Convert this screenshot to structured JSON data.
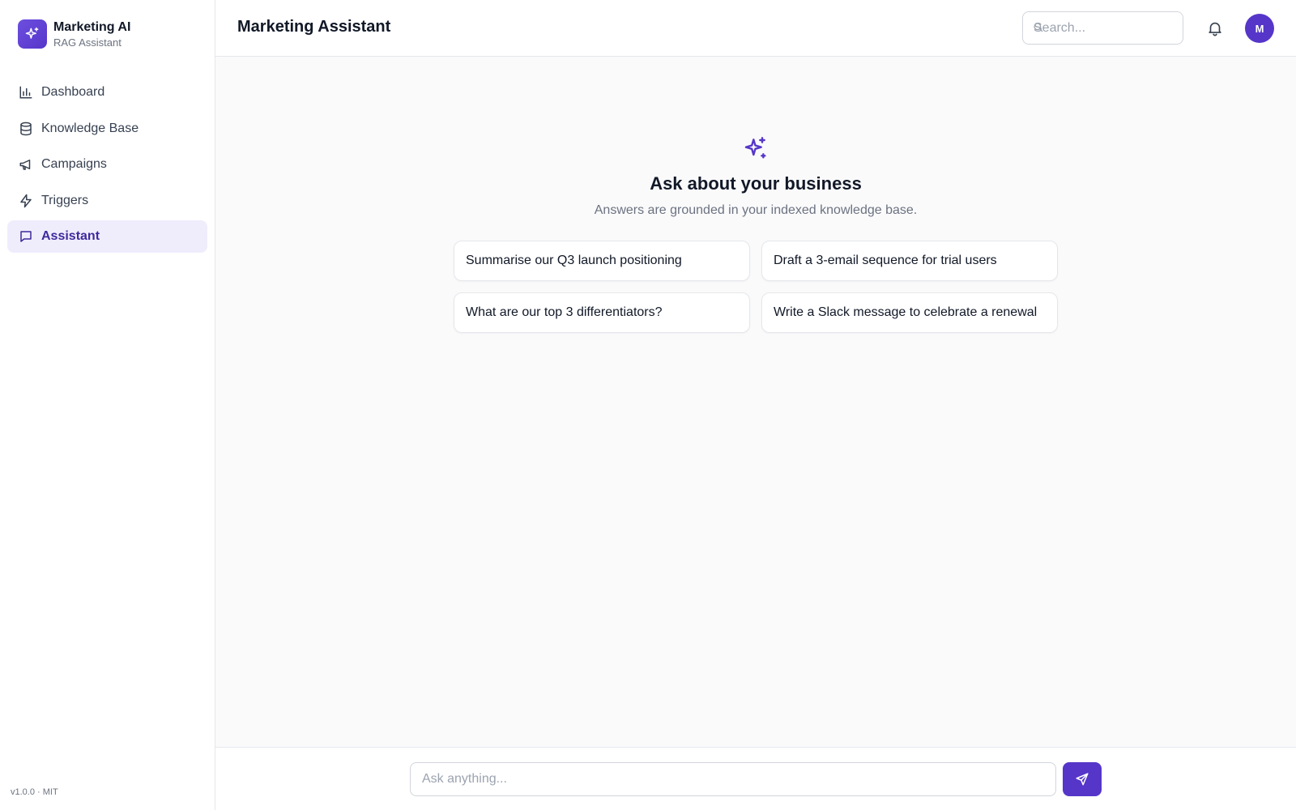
{
  "brand": {
    "name": "Marketing AI",
    "subtitle": "RAG Assistant"
  },
  "sidebar": {
    "items": [
      {
        "label": "Dashboard",
        "icon": "bar-chart-icon",
        "active": false
      },
      {
        "label": "Knowledge Base",
        "icon": "database-icon",
        "active": false
      },
      {
        "label": "Campaigns",
        "icon": "megaphone-icon",
        "active": false
      },
      {
        "label": "Triggers",
        "icon": "lightning-icon",
        "active": false
      },
      {
        "label": "Assistant",
        "icon": "chat-icon",
        "active": true
      }
    ],
    "version": "v1.0.0 · MIT"
  },
  "header": {
    "title": "Marketing Assistant",
    "search_placeholder": "Search...",
    "avatar_initial": "M"
  },
  "main": {
    "title": "Ask about your business",
    "subtitle": "Answers are grounded in your indexed knowledge base.",
    "suggestions": [
      "Summarise our Q3 launch positioning",
      "Draft a 3-email sequence for trial users",
      "What are our top 3 differentiators?",
      "Write a Slack message to celebrate a renewal"
    ]
  },
  "composer": {
    "placeholder": "Ask anything..."
  },
  "colors": {
    "accent": "#5636c9",
    "active_bg": "#efedfc",
    "border": "#e5e7eb",
    "page_bg": "#fafafb"
  }
}
